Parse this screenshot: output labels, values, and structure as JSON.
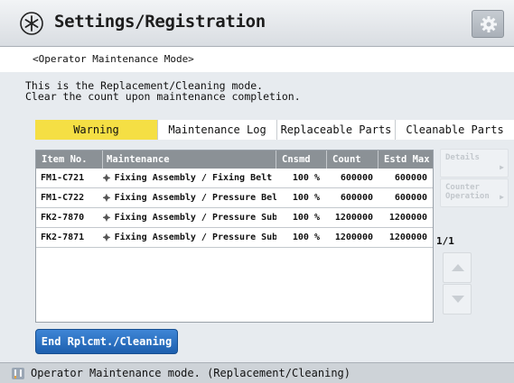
{
  "header": {
    "title": "Settings/Registration",
    "title_icon": "star-asterisk-icon",
    "settings_icon": "gear-icon"
  },
  "mode_label": "<Operator Maintenance Mode>",
  "description": "This is the Replacement/Cleaning mode.\nClear the count upon maintenance completion.",
  "tabs": [
    {
      "label": "Warning",
      "active": true
    },
    {
      "label": "Maintenance Log",
      "active": false
    },
    {
      "label": "Replaceable Parts",
      "active": false
    },
    {
      "label": "Cleanable Parts",
      "active": false
    }
  ],
  "table": {
    "columns": [
      "Item No.",
      "Maintenance",
      "Cnsmd",
      "Count",
      "Estd Max"
    ],
    "rows": [
      {
        "item": "FM1-C721",
        "maintenance": "Fixing Assembly / Fixing Belt Uni",
        "cnsmd": "100 %",
        "count": "600000",
        "estd_max": "600000"
      },
      {
        "item": "FM1-C722",
        "maintenance": "Fixing Assembly / Pressure Belt U",
        "cnsmd": "100 %",
        "count": "600000",
        "estd_max": "600000"
      },
      {
        "item": "FK2-7870",
        "maintenance": "Fixing Assembly / Pressure Sub Th",
        "cnsmd": "100 %",
        "count": "1200000",
        "estd_max": "1200000"
      },
      {
        "item": "FK2-7871",
        "maintenance": "Fixing Assembly / Pressure Sub Th",
        "cnsmd": "100 %",
        "count": "1200000",
        "estd_max": "1200000"
      }
    ]
  },
  "side": {
    "details_label": "Details",
    "counter_label_1": "Counter",
    "counter_label_2": "Operation",
    "page": "1/1"
  },
  "end_button_label": "End Rplcmt./Cleaning",
  "status_text": "Operator Maintenance mode. (Replacement/Cleaning)",
  "colors": {
    "active_tab": "#f5df44",
    "primary_button": "#2a6fc2",
    "table_header": "#8b9196"
  }
}
